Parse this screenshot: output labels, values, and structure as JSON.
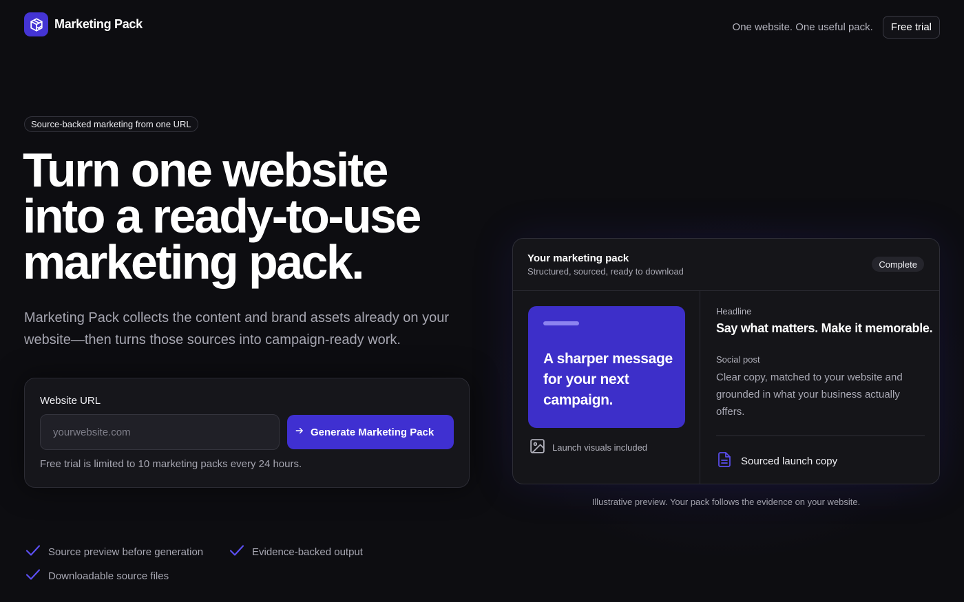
{
  "header": {
    "brand_name": "Marketing Pack",
    "logo_icon": "package-check-icon",
    "tagline": "One website. One useful pack.",
    "free_trial_label": "Free trial"
  },
  "hero": {
    "pill": "Source-backed marketing from one URL",
    "title_lines": [
      "Turn one website",
      "into a ready-to-use",
      "marketing pack."
    ],
    "subtitle": "Marketing Pack collects the content and brand assets already on your website—then turns those sources into campaign-ready work."
  },
  "form": {
    "label": "Website URL",
    "placeholder": "yourwebsite.com",
    "value": "",
    "button_label": "Generate Marketing Pack",
    "button_icon": "arrow-right-icon",
    "note": "Free trial is limited to 10 marketing packs every 24 hours."
  },
  "features": [
    {
      "label": "Source preview before generation",
      "icon": "check-icon"
    },
    {
      "label": "Evidence-backed output",
      "icon": "check-icon"
    },
    {
      "label": "Downloadable source files",
      "icon": "check-icon"
    }
  ],
  "preview": {
    "title": "Your marketing pack",
    "subtitle": "Structured, sourced, ready to download",
    "badge": "Complete",
    "visual_text": "A sharper message for your next campaign.",
    "visual_caption": "Launch visuals included",
    "headline_label": "Headline",
    "headline": "Say what matters. Make it memorable.",
    "social_label": "Social post",
    "social_text": "Clear copy, matched to your website and grounded in what your business actually offers.",
    "sourced_label": "Sourced launch copy",
    "note": "Illustrative preview. Your pack follows the evidence on your website."
  },
  "colors": {
    "accent": "#3f30d1",
    "background": "#0d0d11",
    "check": "#5b4ef0"
  }
}
